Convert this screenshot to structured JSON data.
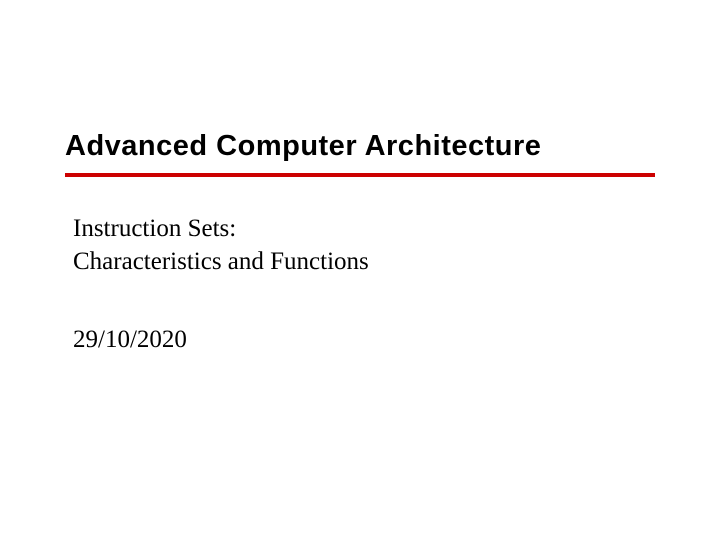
{
  "title": "Advanced Computer Architecture",
  "subtitle_line1": " Instruction Sets:",
  "subtitle_line2": "Characteristics and Functions",
  "date": "29/10/2020",
  "colors": {
    "divider": "#cc0000",
    "text": "#000000"
  }
}
